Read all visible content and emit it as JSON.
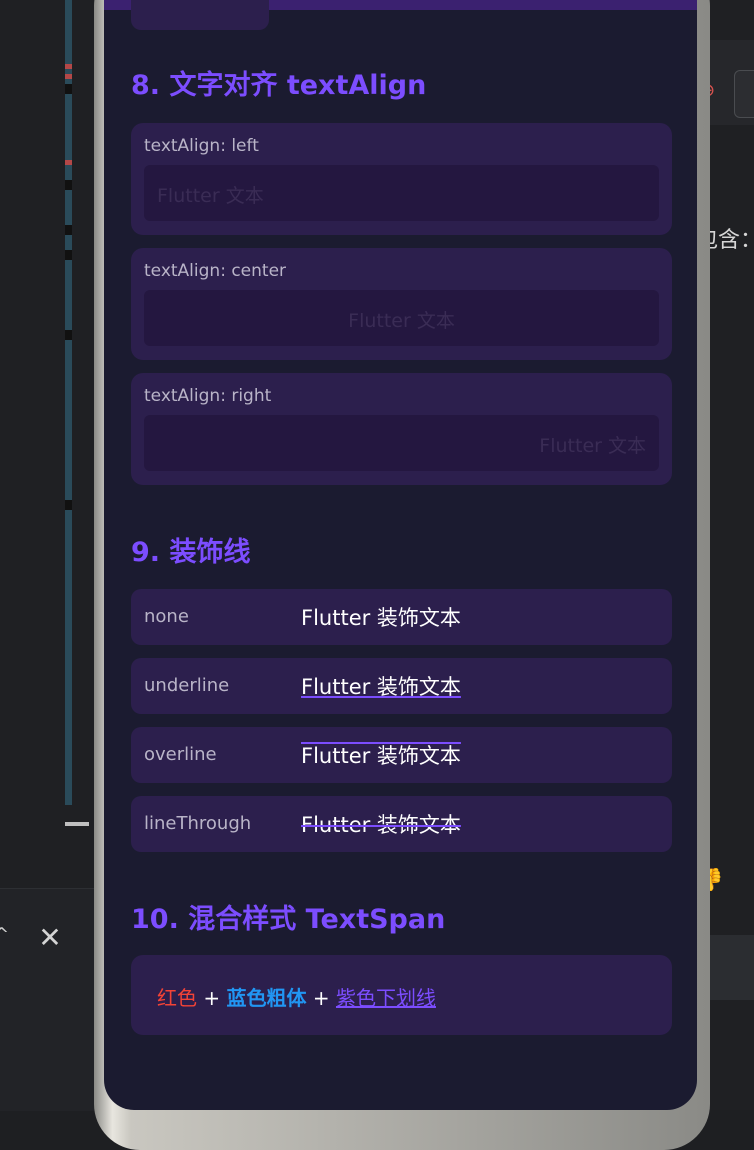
{
  "ide": {
    "close_glyph": "✕",
    "chevron_glyph": "^",
    "right_text": "包含：",
    "right_red_glyph": "⊕",
    "thumb_glyph": "👎"
  },
  "section8": {
    "title": "8. 文字对齐 textAlign",
    "cards": [
      {
        "label": "textAlign: left",
        "sample": "Flutter 文本"
      },
      {
        "label": "textAlign: center",
        "sample": "Flutter 文本"
      },
      {
        "label": "textAlign: right",
        "sample": "Flutter 文本"
      }
    ]
  },
  "section9": {
    "title": "9. 装饰线",
    "rows": [
      {
        "label": "none",
        "sample": "Flutter 装饰文本"
      },
      {
        "label": "underline",
        "sample": "Flutter 装饰文本"
      },
      {
        "label": "overline",
        "sample": "Flutter 装饰文本"
      },
      {
        "label": "lineThrough",
        "sample": "Flutter 装饰文本"
      }
    ]
  },
  "section10": {
    "title": "10. 混合样式 TextSpan",
    "spans": {
      "red": "红色",
      "plus1": " + ",
      "blue": "蓝色粗体",
      "plus2": " + ",
      "purple": "紫色下划线"
    }
  },
  "colors": {
    "accent": "#7c4dff",
    "red": "#f44336",
    "blue": "#2196f3",
    "card": "#2c1f4d",
    "screen": "#1b1b30"
  }
}
